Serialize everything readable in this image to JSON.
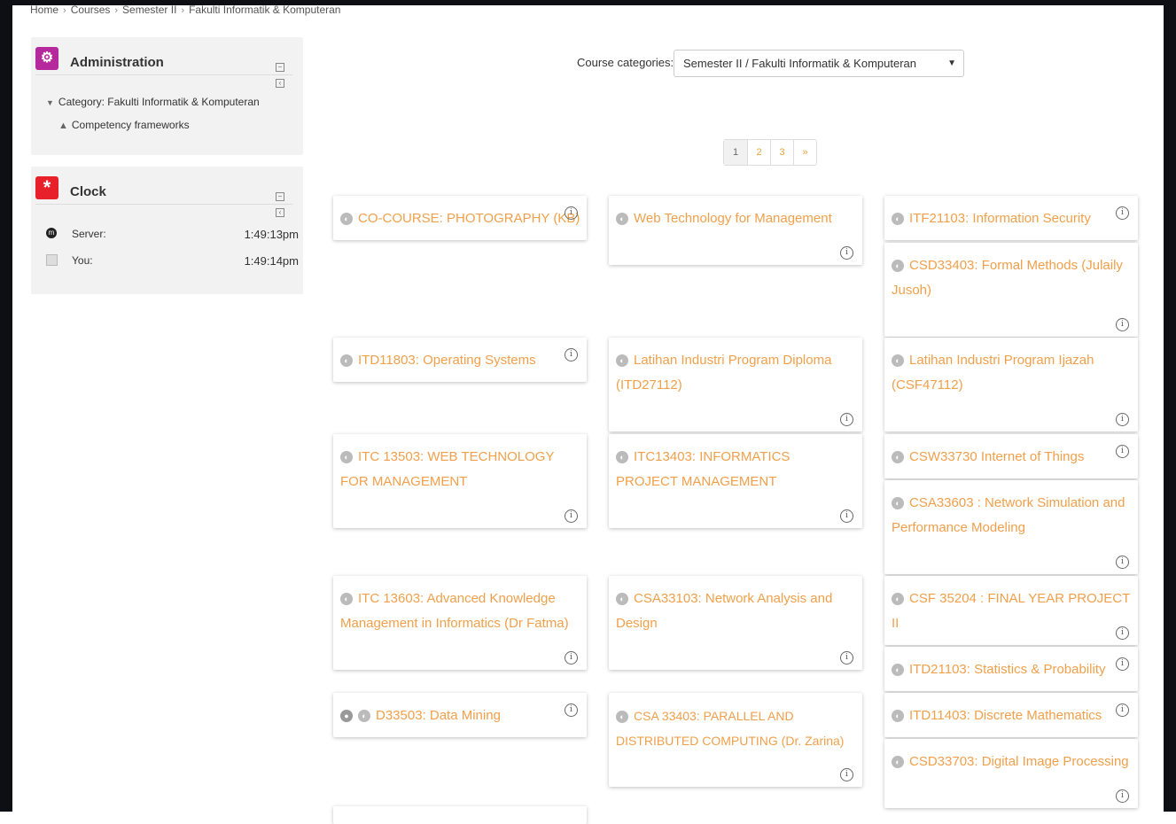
{
  "breadcrumb": [
    "Home",
    "Courses",
    "Semester II",
    "Fakulti Informatik & Komputeran"
  ],
  "breadcrumb_separator": "›",
  "administration": {
    "title": "Administration",
    "category_item": "Category: Fakulti Informatik & Komputeran",
    "competency_item": "Competency frameworks"
  },
  "clock": {
    "title": "Clock",
    "server_label": "Server:",
    "server_time": "1:49:13pm",
    "you_label": "You:",
    "you_time": "1:49:14pm"
  },
  "course_categories": {
    "label": "Course categories:",
    "selected": "Semester II / Fakulti Informatik & Komputeran"
  },
  "pagination": [
    "1",
    "2",
    "3",
    "»"
  ],
  "courses": [
    "CO-COURSE: PHOTOGRAPHY (KB)",
    "Web Technology for Management",
    "ITF21103: Information Security",
    "CSD33403: Formal Methods (Julaily Jusoh)",
    "ITD11803: Operating Systems",
    "Latihan Industri Program Diploma (ITD27112)",
    "Latihan Industri Program Ijazah (CSF47112)",
    "ITC 13503: WEB TECHNOLOGY FOR MANAGEMENT",
    "ITC13403: INFORMATICS PROJECT MANAGEMENT",
    "CSW33730 Internet of Things",
    "CSA33603 : Network Simulation and Performance Modeling",
    "ITC 13603: Advanced Knowledge Management in Informatics (Dr Fatma)",
    "CSA33103: Network Analysis and Design",
    "CSF 35204 : FINAL YEAR PROJECT II",
    "ITD21103: Statistics & Probability",
    "D33503: Data Mining",
    "CSA 33403: PARALLEL AND DISTRIBUTED COMPUTING (Dr. Zarina)",
    "ITD11403: Discrete Mathematics",
    "CSD33703: Digital Image Processing"
  ],
  "colors": {
    "link": "#f0a04b",
    "admin_icon": "#b5299c",
    "clock_icon": "#e8202a"
  }
}
